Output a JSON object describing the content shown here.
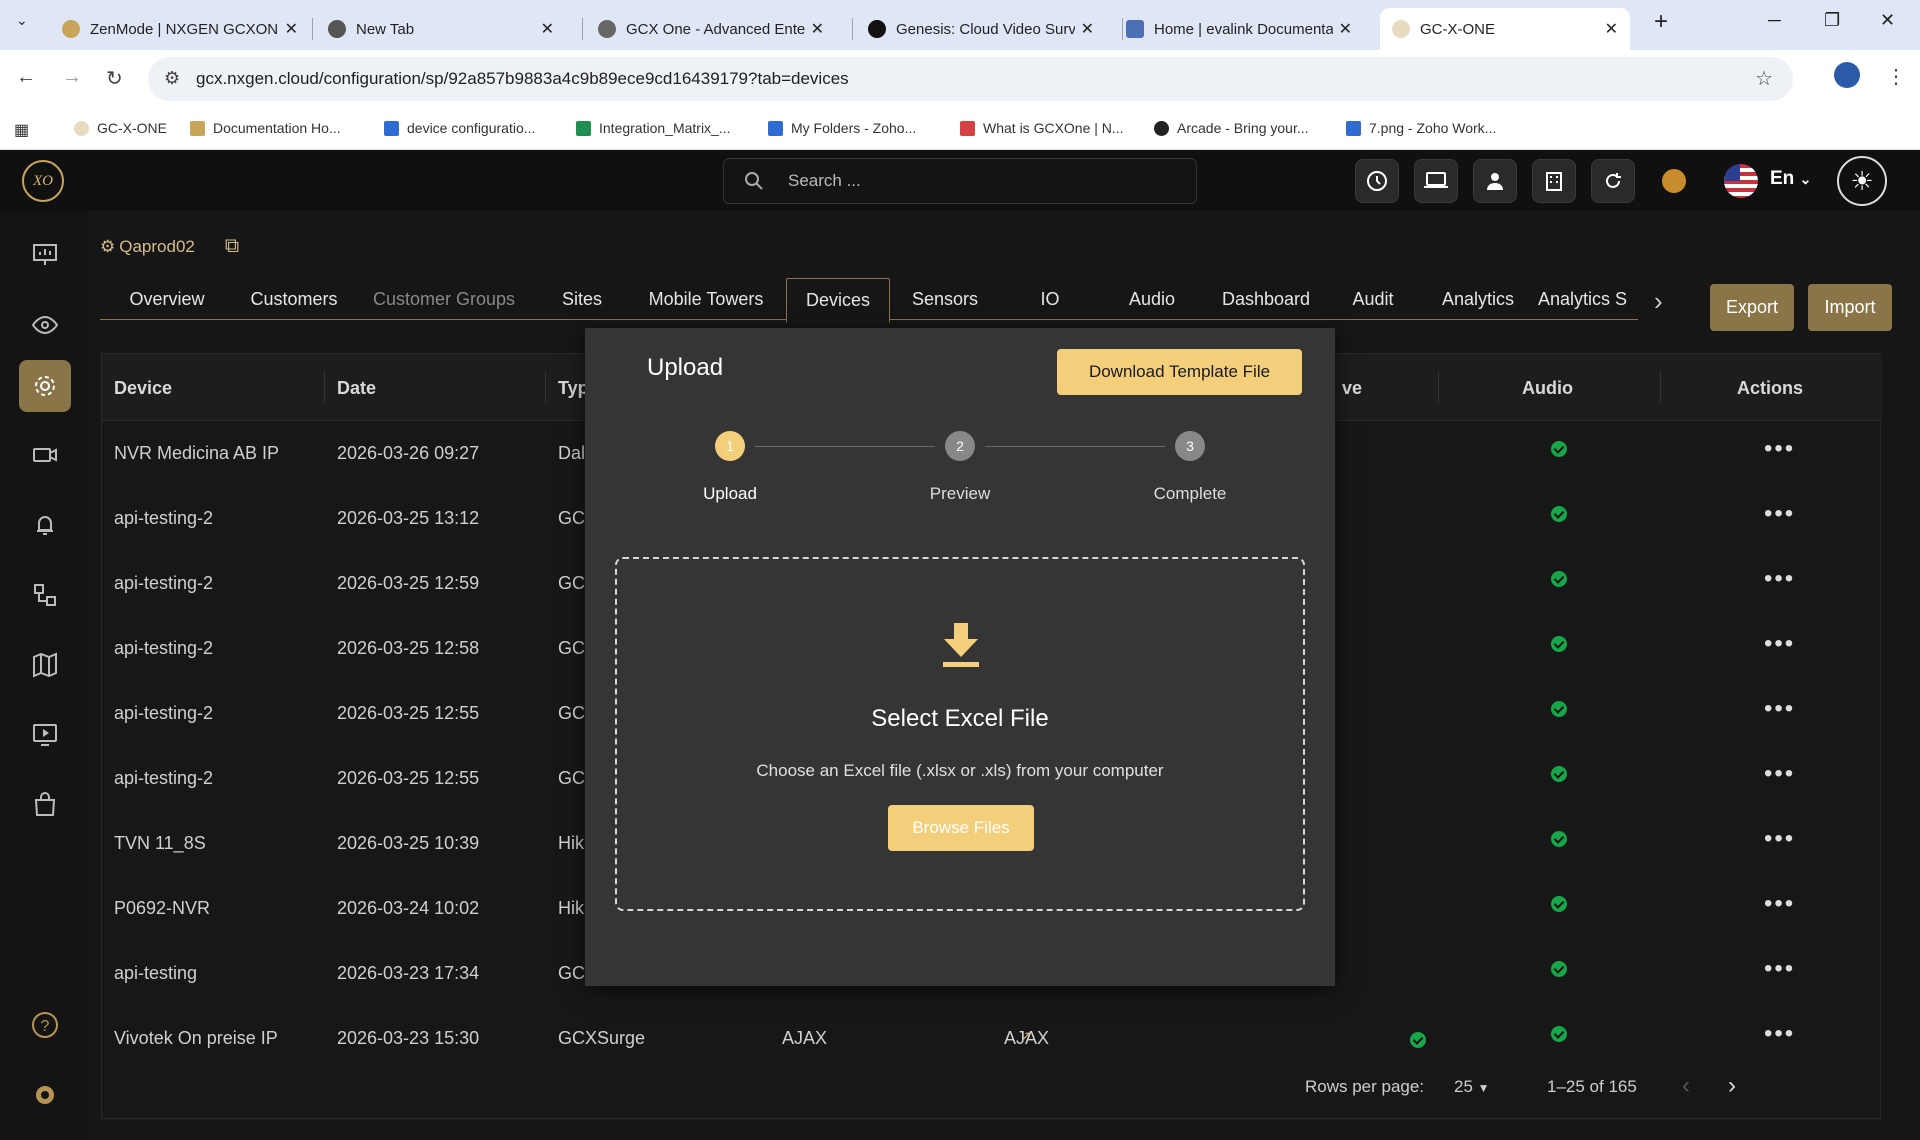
{
  "browser": {
    "tabs": [
      {
        "title": "ZenMode | NXGEN GCXON",
        "active": false
      },
      {
        "title": "New Tab",
        "active": false
      },
      {
        "title": "GCX One - Advanced Enter",
        "active": false
      },
      {
        "title": "Genesis: Cloud Video Surv",
        "active": false
      },
      {
        "title": "Home | evalink Documenta",
        "active": false
      },
      {
        "title": "GC-X-ONE",
        "active": true
      }
    ],
    "url": "gcx.nxgen.cloud/configuration/sp/92a857b9883a4c9b89ece9cd16439179?tab=devices",
    "bookmarks": [
      {
        "label": "GC-X-ONE"
      },
      {
        "label": "Documentation Ho..."
      },
      {
        "label": "device configuratio..."
      },
      {
        "label": "Integration_Matrix_..."
      },
      {
        "label": "My Folders - Zoho..."
      },
      {
        "label": "What is GCXOne | N..."
      },
      {
        "label": "Arcade - Bring your..."
      },
      {
        "label": "7.png - Zoho Work..."
      }
    ]
  },
  "header": {
    "logo_text": "XO",
    "search_placeholder": "Search ...",
    "language": "En"
  },
  "breadcrumb": {
    "label": "Qaprod02"
  },
  "main_tabs": [
    {
      "label": "Overview"
    },
    {
      "label": "Customers"
    },
    {
      "label": "Customer Groups"
    },
    {
      "label": "Sites"
    },
    {
      "label": "Mobile Towers"
    },
    {
      "label": "Devices"
    },
    {
      "label": "Sensors"
    },
    {
      "label": "IO"
    },
    {
      "label": "Audio"
    },
    {
      "label": "Dashboard"
    },
    {
      "label": "Audit"
    },
    {
      "label": "Analytics"
    },
    {
      "label": "Analytics S"
    }
  ],
  "actions": {
    "export": "Export",
    "import": "Import"
  },
  "table": {
    "headers": {
      "device": "Device",
      "date": "Date",
      "type": "Typ",
      "live": "ve",
      "audio": "Audio",
      "actions": "Actions"
    },
    "rows": [
      {
        "device": "NVR Medicina AB IP",
        "date": "2026-03-26 09:27",
        "type": "Dal"
      },
      {
        "device": "api-testing-2",
        "date": "2026-03-25 13:12",
        "type": "GC"
      },
      {
        "device": "api-testing-2",
        "date": "2026-03-25 12:59",
        "type": "GC"
      },
      {
        "device": "api-testing-2",
        "date": "2026-03-25 12:58",
        "type": "GC"
      },
      {
        "device": "api-testing-2",
        "date": "2026-03-25 12:55",
        "type": "GC"
      },
      {
        "device": "api-testing-2",
        "date": "2026-03-25 12:55",
        "type": "GC"
      },
      {
        "device": "TVN 11_8S",
        "date": "2026-03-25 10:39",
        "type": "Hik"
      },
      {
        "device": "P0692-NVR",
        "date": "2026-03-24 10:02",
        "type": "Hik"
      },
      {
        "device": "api-testing",
        "date": "2026-03-23 17:34",
        "type": "GC"
      },
      {
        "device": "Vivotek On preise IP",
        "date": "2026-03-23 15:30",
        "type": "GCXSurge",
        "c4": "AJAX",
        "c5": "AJAX"
      }
    ],
    "actions_glyph": "•••",
    "footer": {
      "rows_per_page_label": "Rows per page:",
      "rows_per_page_value": "25",
      "range": "1–25 of 165"
    }
  },
  "modal": {
    "title": "Upload",
    "download_label": "Download Template File",
    "steps": [
      {
        "num": "1",
        "label": "Upload"
      },
      {
        "num": "2",
        "label": "Preview"
      },
      {
        "num": "3",
        "label": "Complete"
      }
    ],
    "drop_title": "Select Excel File",
    "drop_hint": "Choose an Excel file (.xlsx or .xls) from your computer",
    "browse_label": "Browse Files"
  },
  "colors": {
    "accent": "#f4cf7b",
    "gold_dark": "#8a7548",
    "success": "#17a74a",
    "modal_bg": "#353535"
  }
}
